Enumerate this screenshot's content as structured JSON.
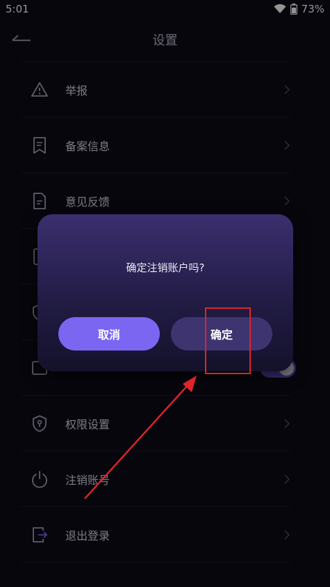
{
  "status_bar": {
    "time": "5:01",
    "battery_percent": "73%",
    "icons": [
      "wifi-icon",
      "battery-icon"
    ]
  },
  "header": {
    "title": "设置",
    "back_icon": "back-arrow-icon"
  },
  "settings_items": [
    {
      "label": "举报",
      "icon": "alert-triangle-icon"
    },
    {
      "label": "备案信息",
      "icon": "bookmark-doc-icon"
    },
    {
      "label": "意见反馈",
      "icon": "feedback-doc-icon"
    },
    {
      "label": "",
      "icon": "document-icon"
    },
    {
      "label": "",
      "icon": "shield-icon"
    },
    {
      "label": "",
      "icon": "square-icon",
      "toggle": true
    },
    {
      "label": "权限设置",
      "icon": "shield-key-icon"
    },
    {
      "label": "注销账号",
      "icon": "power-icon"
    },
    {
      "label": "退出登录",
      "icon": "logout-icon"
    }
  ],
  "dialog": {
    "message": "确定注销账户吗?",
    "cancel_label": "取消",
    "confirm_label": "确定"
  },
  "annotation": {
    "highlight_color": "#e0242a",
    "target": "确定"
  },
  "colors": {
    "background": "#0d0b18",
    "accent": "#7b66f2",
    "confirm_button": "#3d3470"
  }
}
